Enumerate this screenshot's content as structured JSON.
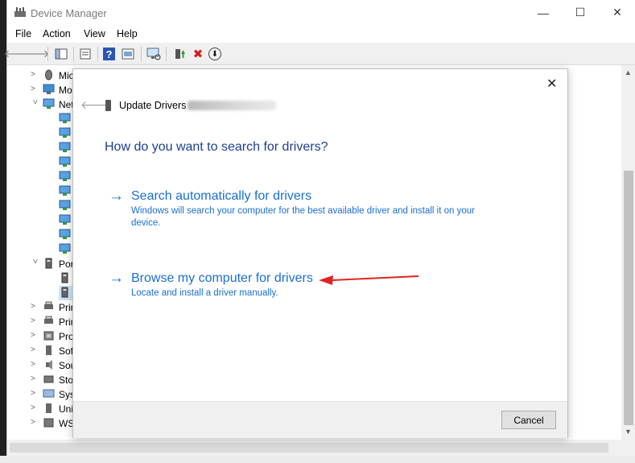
{
  "window": {
    "title": "Device Manager",
    "minimize_glyph": "—",
    "maximize_glyph": "☐",
    "close_glyph": "✕"
  },
  "menu": [
    "File",
    "Action",
    "View",
    "Help"
  ],
  "toolbar": {
    "icons": [
      "back-icon",
      "forward-icon",
      "console-tree-icon",
      "properties-icon",
      "help-icon",
      "device-icon",
      "scan-hardware-icon",
      "update-driver-icon",
      "uninstall-icon",
      "disable-icon"
    ],
    "back": "🡐",
    "forward": "🡒",
    "help": "?",
    "uninstall": "✖",
    "disable": "⬇"
  },
  "tree": {
    "nodes": [
      {
        "label": "Mic",
        "expanded": false
      },
      {
        "label": "Mo",
        "expanded": false
      },
      {
        "label": "Net",
        "expanded": true
      },
      {
        "label": "Por",
        "expanded": true
      },
      {
        "label": "Prir",
        "expanded": false
      },
      {
        "label": "Prin",
        "expanded": false
      },
      {
        "label": "Pro",
        "expanded": false
      },
      {
        "label": "Sof",
        "expanded": false
      },
      {
        "label": "Sou",
        "expanded": false
      },
      {
        "label": "Sto",
        "expanded": false
      },
      {
        "label": "Syst",
        "expanded": false
      },
      {
        "label": "Uni",
        "expanded": false
      },
      {
        "label": "WS",
        "expanded": false
      }
    ],
    "network_children_count": 10,
    "port_children_count": 2
  },
  "dialog": {
    "close_glyph": "✕",
    "back_glyph": "🡐",
    "title": "Update Drivers - ",
    "question": "How do you want to search for drivers?",
    "options": [
      {
        "arrow": "→",
        "title": "Search automatically for drivers",
        "description": "Windows will search your computer for the best available driver and install it on your device."
      },
      {
        "arrow": "→",
        "title": "Browse my computer for drivers",
        "description": "Locate and install a driver manually."
      }
    ],
    "cancel_label": "Cancel"
  },
  "colors": {
    "link_blue": "#1a6fd1",
    "heading_blue": "#1c3f8f",
    "annotation_red": "#e02424"
  }
}
